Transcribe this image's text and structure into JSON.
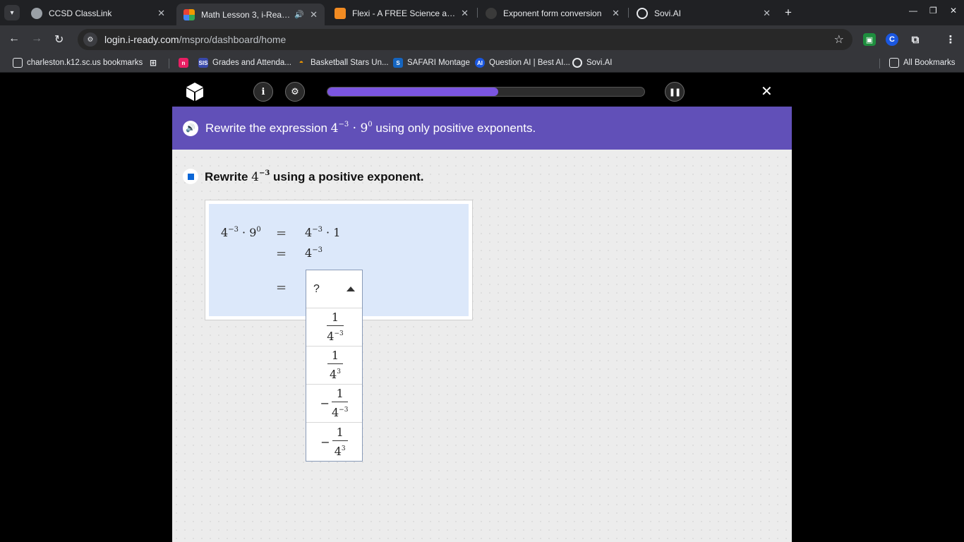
{
  "browser": {
    "tabs": [
      {
        "title": "CCSD ClassLink",
        "active": false,
        "favicon_color": "#9aa0a6"
      },
      {
        "title": "Math Lesson 3, i-Ready",
        "active": true,
        "favicon_color": "#f29900"
      },
      {
        "title": "Flexi - A FREE Science and Mat",
        "active": false,
        "favicon_color": "#f28b22"
      },
      {
        "title": "Exponent form conversion",
        "active": false,
        "favicon_color": "#444"
      },
      {
        "title": "Sovi.AI",
        "active": false,
        "favicon_color": "#e8eaed"
      }
    ],
    "address": {
      "host": "login.i-ready.com",
      "path": "/mspro/dashboard/home"
    },
    "bookmarks": [
      {
        "label": "charleston.k12.sc.us bookmarks"
      },
      {
        "label": "Grades and Attenda..."
      },
      {
        "label": "Basketball Stars Un..."
      },
      {
        "label": "SAFARI Montage"
      },
      {
        "label": "Question AI | Best AI..."
      },
      {
        "label": "Sovi.AI"
      }
    ],
    "all_bookmarks": "All Bookmarks",
    "bookmark_icons": {
      "n_badge": "n",
      "sis_badge": "SIS",
      "ai_badge": "AI"
    },
    "extensions": {
      "c_ext": "C"
    }
  },
  "app": {
    "info_label": "i",
    "progress": 0.54,
    "accent": "#6150b8",
    "question": {
      "prefix": "Rewrite the expression ",
      "base1": "4",
      "exp1": "−3",
      "dot": " · ",
      "base2": "9",
      "exp2": "0",
      "suffix": " using only positive exponents."
    },
    "sub_question": {
      "prefix": "Rewrite ",
      "base": "4",
      "exp": "−3",
      "suffix": " using a positive exponent."
    },
    "work": {
      "lhs_base1": "4",
      "lhs_exp1": "−3",
      "lhs_dot": " · ",
      "lhs_base2": "9",
      "lhs_exp2": "0",
      "eq": "=",
      "row1_base": "4",
      "row1_exp": "−3",
      "row1_tail": " · 1",
      "row2_base": "4",
      "row2_exp": "−3"
    },
    "dropdown": {
      "selected": "?",
      "options": [
        {
          "neg": "",
          "num": "1",
          "den_base": "4",
          "den_exp": "−3"
        },
        {
          "neg": "",
          "num": "1",
          "den_base": "4",
          "den_exp": "3"
        },
        {
          "neg": "−",
          "num": "1",
          "den_base": "4",
          "den_exp": "−3"
        },
        {
          "neg": "−",
          "num": "1",
          "den_base": "4",
          "den_exp": "3"
        }
      ]
    }
  }
}
